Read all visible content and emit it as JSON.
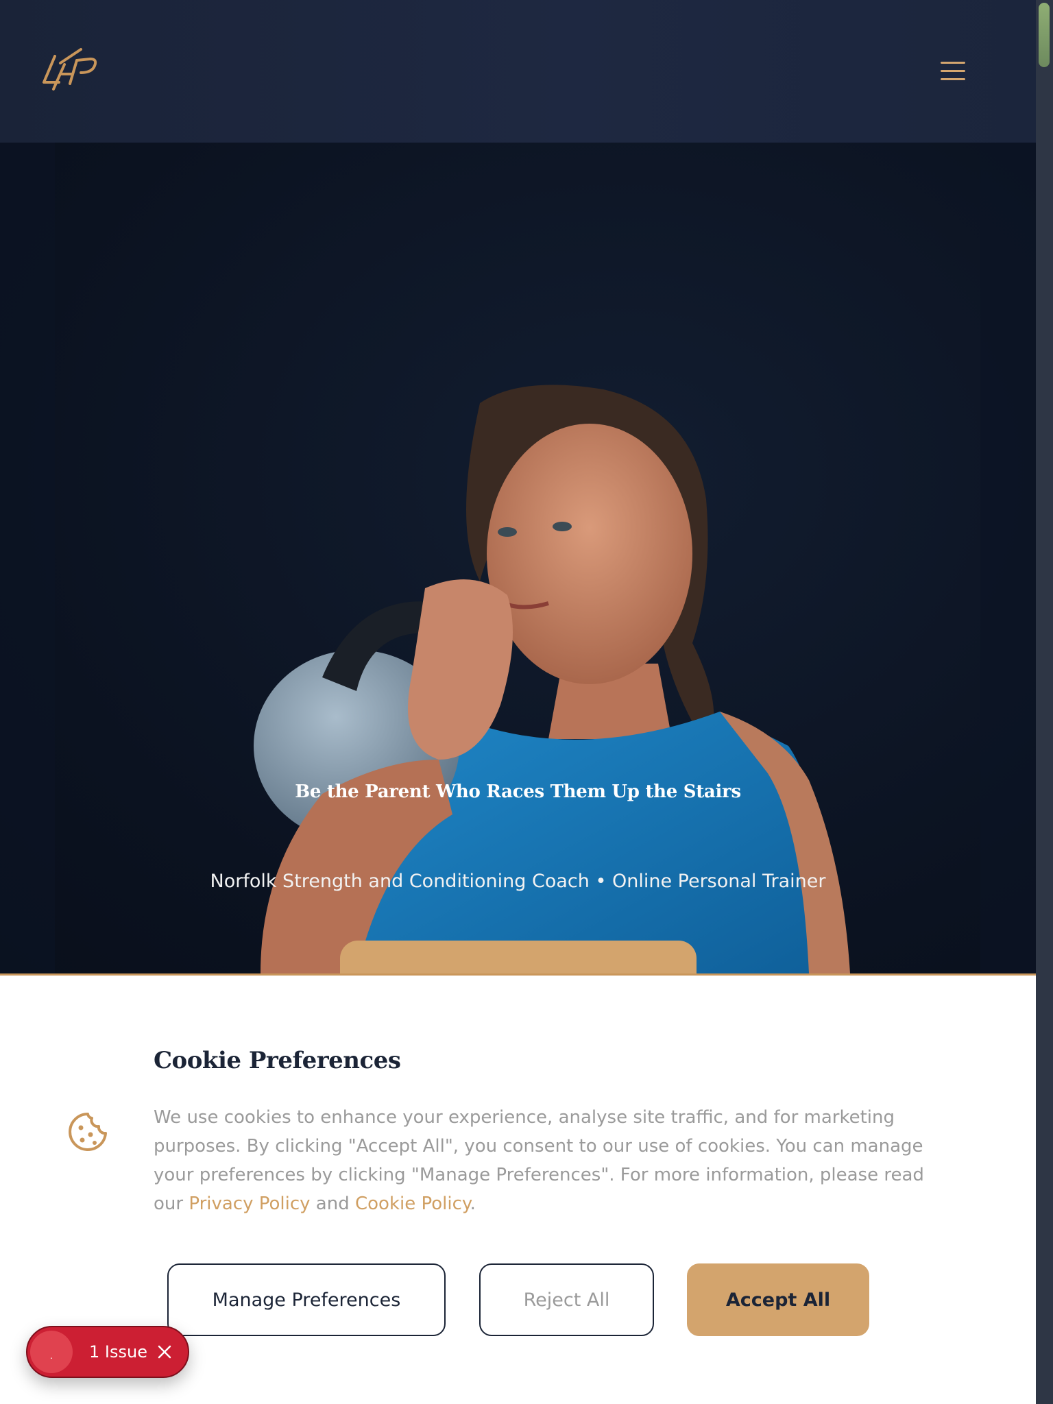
{
  "header": {
    "logo_alt": "LFP",
    "menu_icon": "hamburger-menu-icon"
  },
  "hero": {
    "title": "Be the Parent Who Races Them Up the Stairs",
    "subtitle": "Norfolk Strength and Conditioning Coach • Online Personal Trainer",
    "photo": "woman-holding-kettlebell"
  },
  "cookie": {
    "icon": "cookie-icon",
    "title": "Cookie Preferences",
    "text_before": "We use cookies to enhance your experience, analyse site traffic, and for marketing purposes. By clicking \"Accept All\", you consent to our use of cookies. You can manage your preferences by clicking \"Manage Preferences\". For more information, please read our ",
    "privacy_link": "Privacy Policy",
    "text_and": " and ",
    "cookie_link": "Cookie Policy",
    "text_end": ".",
    "manage_label": "Manage Preferences",
    "reject_label": "Reject All",
    "accept_label": "Accept All"
  },
  "issue_badge": {
    "dot_text": ".",
    "label": "1 Issue",
    "close_icon": "close-icon"
  },
  "colors": {
    "navy": "#1b2436",
    "gold": "#d3a46d",
    "issue_red": "#cc1f33"
  }
}
